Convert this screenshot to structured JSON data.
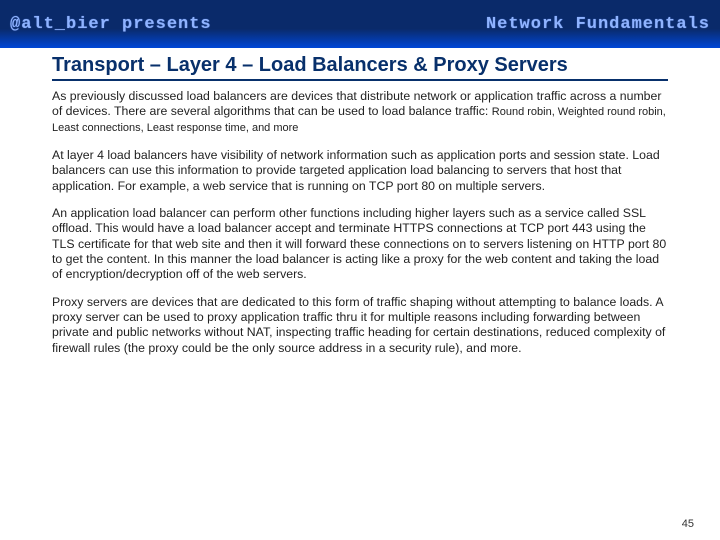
{
  "banner": {
    "left": "@alt_bier presents",
    "right": "Network Fundamentals"
  },
  "title": "Transport – Layer 4 – Load Balancers & Proxy Servers",
  "p1_main": "As previously discussed load balancers are devices that distribute network or application traffic across a number of devices. There are several algorithms that can be used to load balance traffic: ",
  "p1_algos": "Round robin, Weighted round robin, Least connections, Least response time, and more",
  "p2": "At layer 4 load balancers have visibility of network information such as application ports and session state.  Load balancers can use this information to provide targeted application load balancing to servers that host that application.  For example, a web service that is running on TCP port 80 on multiple servers.",
  "p3": "An application load balancer can perform other functions including higher layers such as a service called SSL offload.  This would have a load balancer accept and terminate HTTPS connections at TCP port 443 using the TLS certificate for that web site and then it will forward these connections on to servers listening on HTTP port 80 to get the content.  In this manner the load balancer is acting like a proxy for the web content and taking the load of encryption/decryption off of the web servers.",
  "p4": "Proxy servers are devices that are dedicated to this form of traffic shaping without attempting to balance loads.  A proxy server can be used to proxy application traffic thru it for multiple reasons including forwarding between private and public networks without NAT, inspecting traffic heading for certain destinations, reduced complexity of firewall rules (the proxy could be the only source address in a security rule), and more.",
  "page_number": "45"
}
